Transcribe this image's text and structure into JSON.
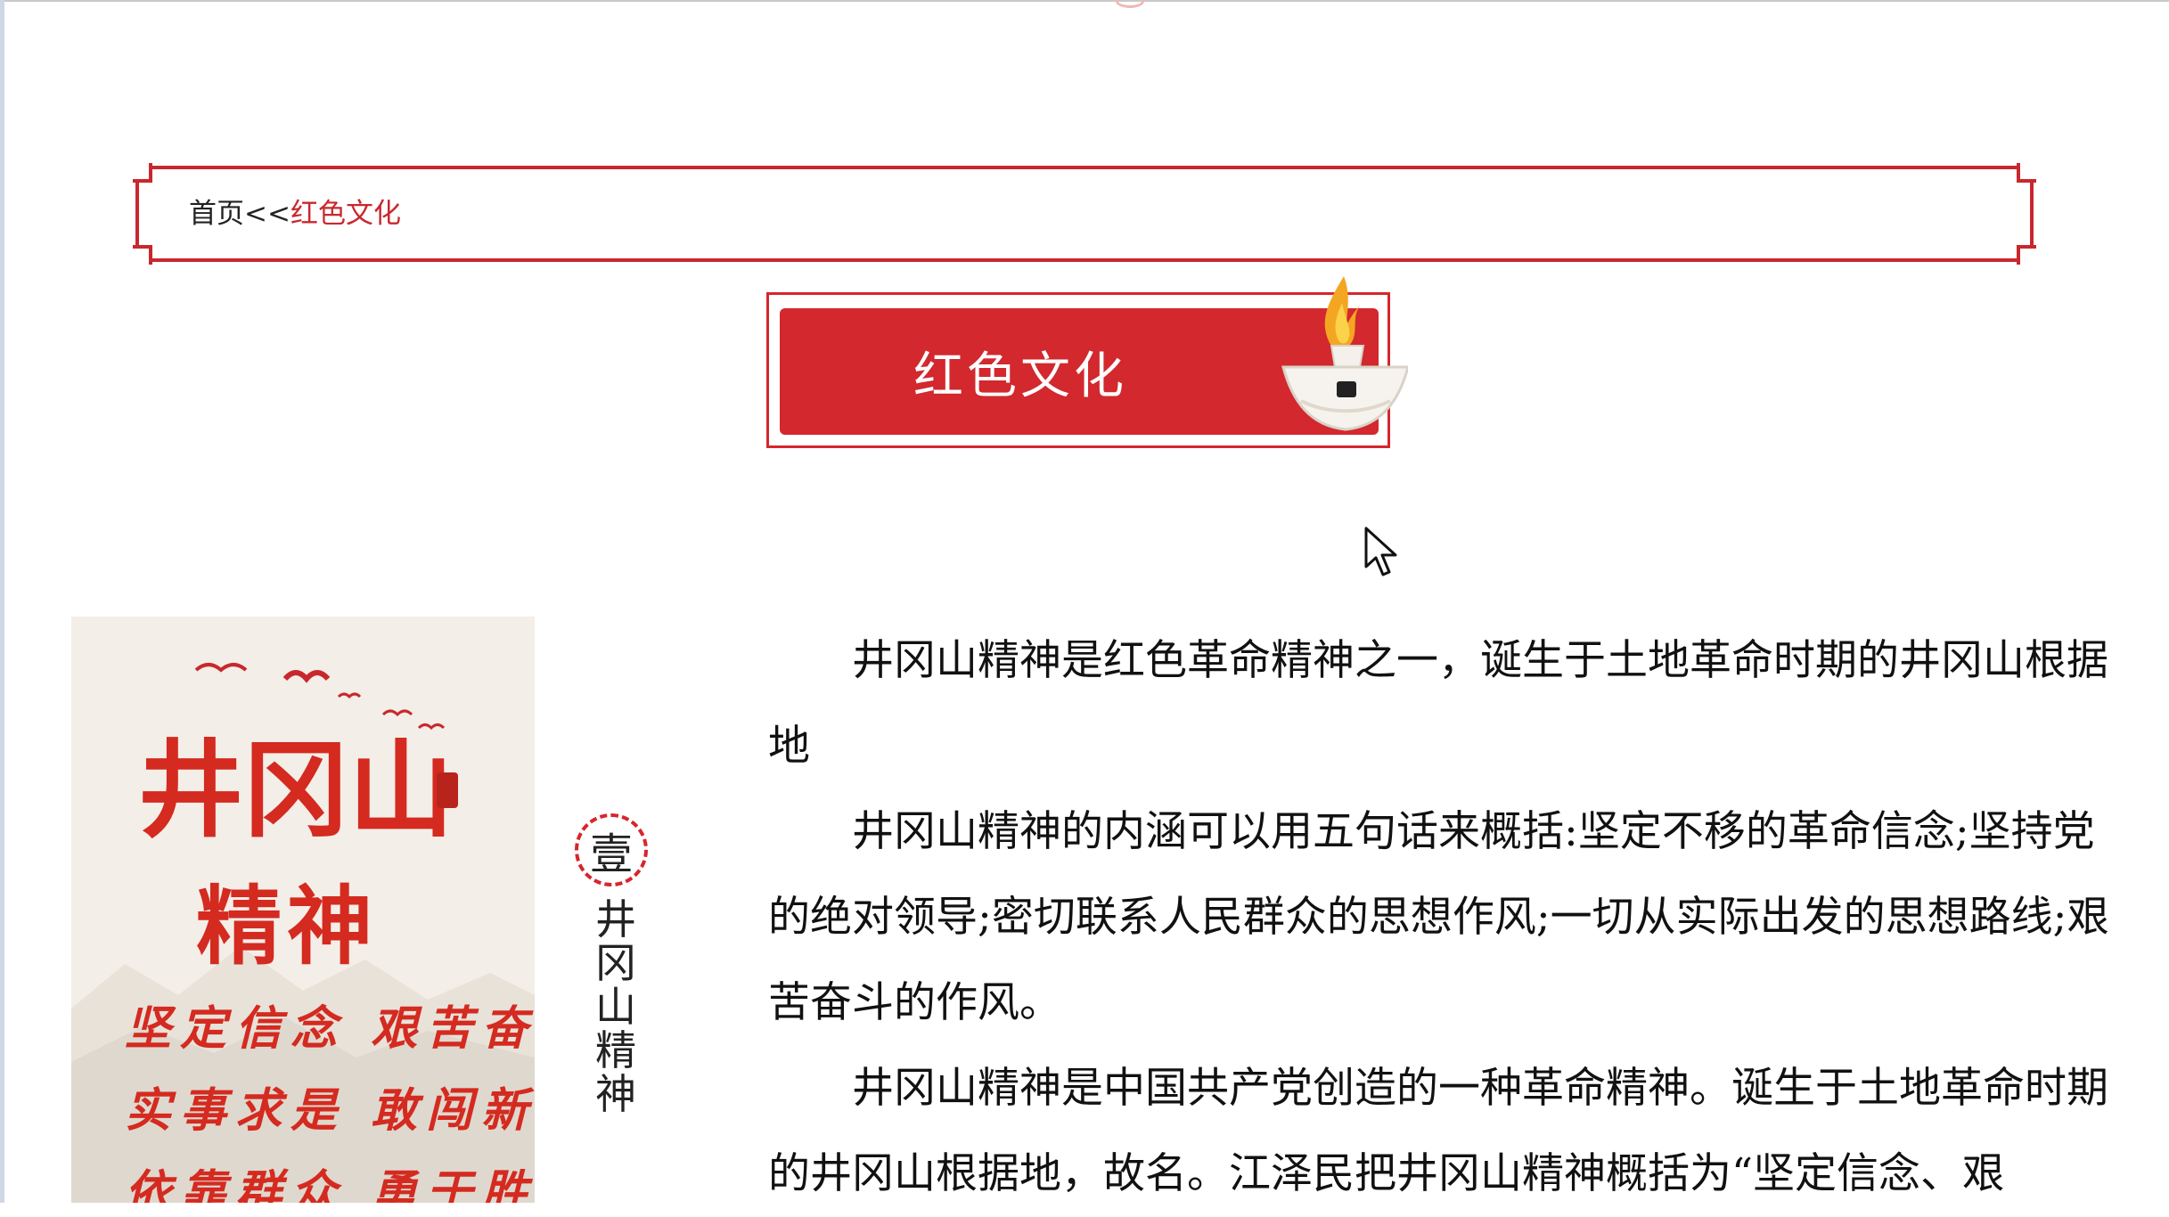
{
  "breadcrumb": {
    "home": "首页",
    "separator": "<<",
    "current": "红色文化"
  },
  "banner": {
    "title": "红色文化"
  },
  "poster": {
    "title_line1": "井冈山",
    "title_line2": "精神",
    "slogan_line1": "坚定信念 艰苦奋斗",
    "slogan_line2": "实事求是 敢闯新路",
    "slogan_line3": "依靠群众 勇于胜利"
  },
  "caption": {
    "badge": "壹",
    "vertical_text": "井冈山精神"
  },
  "article": {
    "paragraphs": [
      "井冈山精神是红色革命精神之一，诞生于土地革命时期的井冈山根据地",
      "井冈山精神的内涵可以用五句话来概括:坚定不移的革命信念;坚持党的绝对领导;密切联系人民群众的思想作风;一切从实际出发的思想路线;艰苦奋斗的作风。",
      "井冈山精神是中国共产党创造的一种革命精神。诞生于土地革命时期的井冈山根据地，故名。江泽民把井冈山精神概括为“坚定信念、艰"
    ]
  },
  "colors": {
    "accent_red": "#c8282d",
    "banner_red": "#d2282e"
  }
}
